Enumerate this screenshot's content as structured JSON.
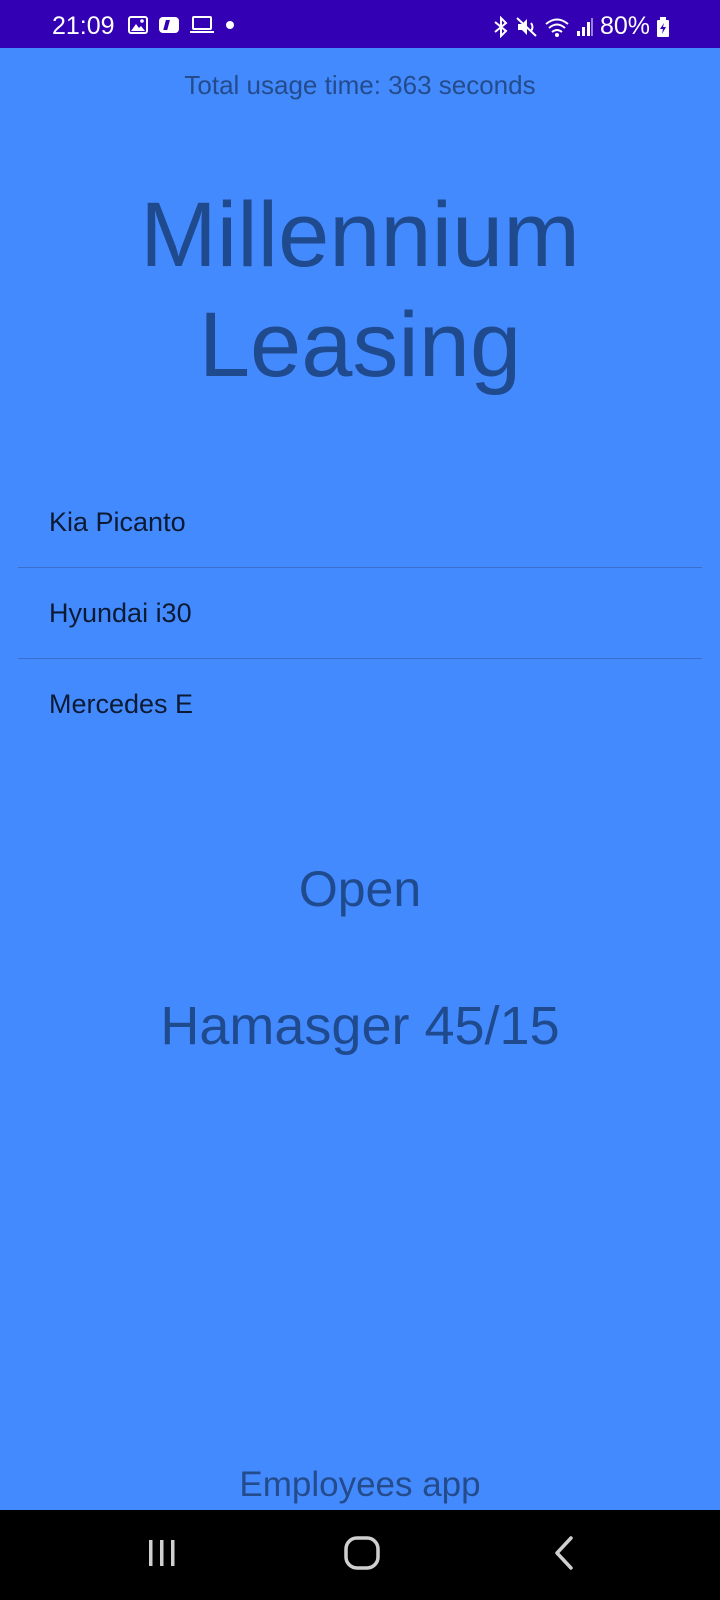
{
  "status_bar": {
    "time": "21:09",
    "battery": "80%",
    "icons": [
      "gallery-icon",
      "notification-app-icon",
      "laptop-icon",
      "dot-icon",
      "bluetooth-icon",
      "mute-icon",
      "wifi-icon",
      "signal-icon",
      "battery-icon"
    ],
    "background": "#3300b3"
  },
  "usage": {
    "text": "Total usage time: 363 seconds"
  },
  "title": {
    "line1": "Millennium",
    "line2": "Leasing"
  },
  "cars": [
    {
      "label": "Kia Picanto"
    },
    {
      "label": "Hyundai i30"
    },
    {
      "label": "Mercedes E"
    }
  ],
  "status": {
    "open_label": "Open",
    "address": "Hamasger 45/15"
  },
  "footer": {
    "label": "Employees app"
  },
  "nav_bar": {
    "buttons": [
      "recents-icon",
      "home-icon",
      "back-icon"
    ]
  },
  "colors": {
    "background": "#448aff",
    "text_primary": "#1f4a8e",
    "list_text": "#0c1b33"
  }
}
